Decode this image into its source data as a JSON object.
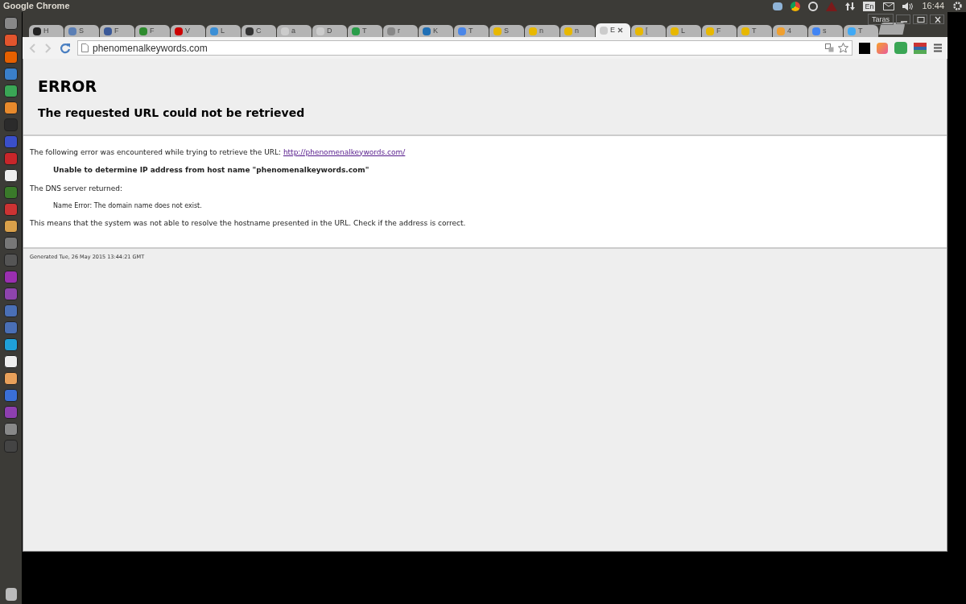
{
  "top_panel": {
    "title": "Google Chrome",
    "clock": "16:44",
    "keyboard_layout": "En"
  },
  "window": {
    "user": "Taras"
  },
  "tabs": [
    {
      "label": "H",
      "selected": false
    },
    {
      "label": "S",
      "selected": false
    },
    {
      "label": "F",
      "selected": false
    },
    {
      "label": "F",
      "selected": false
    },
    {
      "label": "V",
      "selected": false
    },
    {
      "label": "L",
      "selected": false
    },
    {
      "label": "C",
      "selected": false
    },
    {
      "label": "a",
      "selected": false
    },
    {
      "label": "D",
      "selected": false
    },
    {
      "label": "T",
      "selected": false
    },
    {
      "label": "r",
      "selected": false
    },
    {
      "label": "K",
      "selected": false
    },
    {
      "label": "T",
      "selected": false
    },
    {
      "label": "S",
      "selected": false
    },
    {
      "label": "n",
      "selected": false
    },
    {
      "label": "n",
      "selected": false
    },
    {
      "label": "E",
      "selected": true
    },
    {
      "label": "[",
      "selected": false
    },
    {
      "label": "L",
      "selected": false
    },
    {
      "label": "F",
      "selected": false
    },
    {
      "label": "T",
      "selected": false
    },
    {
      "label": "4",
      "selected": false
    },
    {
      "label": "s",
      "selected": false
    },
    {
      "label": "T",
      "selected": false
    }
  ],
  "toolbar": {
    "url": "phenomenalkeywords.com"
  },
  "page": {
    "heading": "ERROR",
    "subheading": "The requested URL could not be retrieved",
    "intro": "The following error was encountered while trying to retrieve the URL: ",
    "link": "http://phenomenalkeywords.com/",
    "error": "Unable to determine IP address from host name \"phenomenalkeywords.com\"",
    "dns_label": "The DNS server returned:",
    "dns_message": "Name Error: The domain name does not exist.",
    "explanation": "This means that the system was not able to resolve the hostname presented in the URL. Check if the address is correct.",
    "footer": "Generated Tue, 26 May 2015 13:44:21 GMT"
  }
}
